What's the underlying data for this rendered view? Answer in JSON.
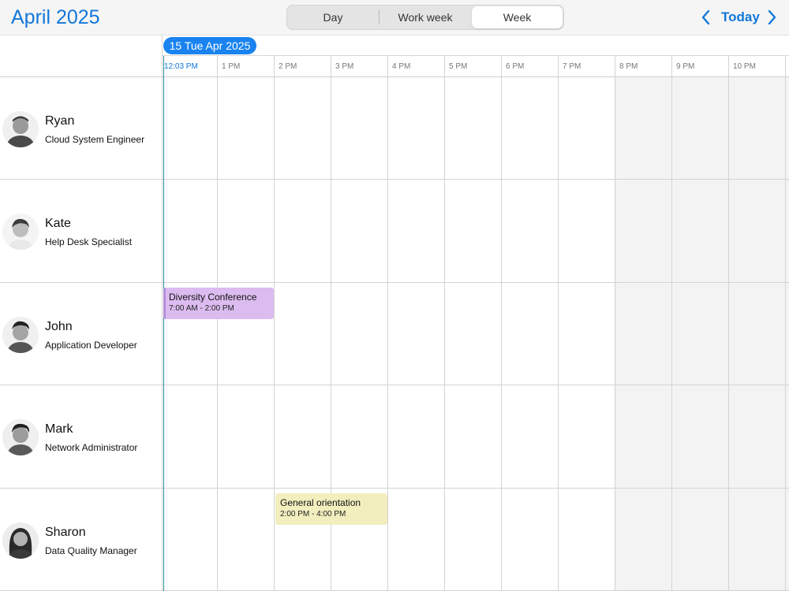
{
  "header": {
    "month_title": "April 2025",
    "views": [
      {
        "label": "Day",
        "selected": false
      },
      {
        "label": "Work week",
        "selected": false
      },
      {
        "label": "Week",
        "selected": true
      }
    ],
    "today_label": "Today",
    "prev_icon": "chevron-left-icon",
    "next_icon": "chevron-right-icon"
  },
  "date_pill": "15 Tue Apr 2025",
  "time_labels": [
    "12:03 PM",
    "1 PM",
    "2 PM",
    "3 PM",
    "4 PM",
    "5 PM",
    "6 PM",
    "7 PM",
    "8 PM",
    "9 PM",
    "10 PM"
  ],
  "resources": [
    {
      "name": "Ryan",
      "role": "Cloud System Engineer"
    },
    {
      "name": "Kate",
      "role": "Help Desk Specialist"
    },
    {
      "name": "John",
      "role": "Application Developer"
    },
    {
      "name": "Mark",
      "role": "Network Administrator"
    },
    {
      "name": "Sharon",
      "role": "Data Quality Manager"
    }
  ],
  "events": [
    {
      "title": "Diversity Conference",
      "time": "7:00 AM - 2:00 PM",
      "resource": "John",
      "color": "#dcbcf0"
    },
    {
      "title": "General orientation",
      "time": "2:00 PM - 4:00 PM",
      "resource": "Sharon",
      "color": "#f2eebe"
    }
  ],
  "colors": {
    "accent": "#1277d9",
    "today_pill": "#1a83f0",
    "now_line": "#2a8d9a",
    "off_hours": "#f3f3f3"
  }
}
